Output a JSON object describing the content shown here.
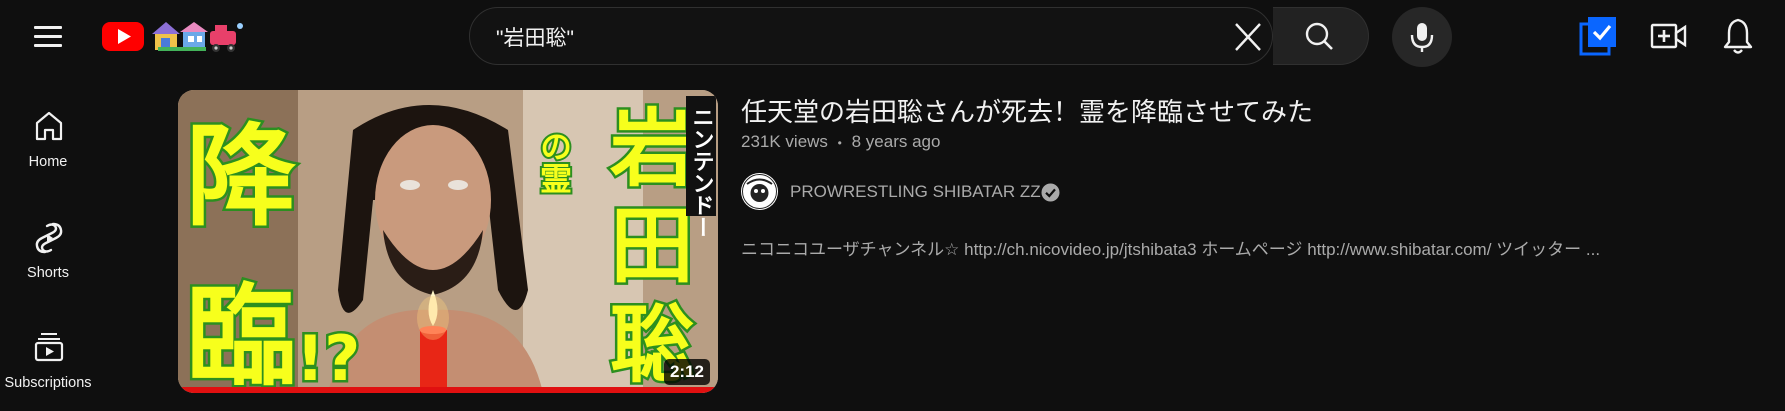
{
  "search": {
    "value": "\"岩田聡\""
  },
  "sidebar": {
    "items": [
      {
        "label": "Home"
      },
      {
        "label": "Shorts"
      },
      {
        "label": "Subscriptions"
      }
    ]
  },
  "result": {
    "title": "任天堂の岩田聡さんが死去！霊を降臨させてみた",
    "views": "231K views",
    "separator": "•",
    "age": "8 years ago",
    "channel": "PROWRESTLING SHIBATAR ZZ",
    "description": "ニコニコユーザチャンネル☆ http://ch.nicovideo.jp/jtshibata3 ホームページ http://www.shibatar.com/ ツイッター ...",
    "duration": "2:12",
    "watch_progress": 1.0,
    "thumbnail_text": {
      "left_chars": [
        "降",
        "臨"
      ],
      "left_suffix": "!?",
      "right_chars": [
        "岩",
        "田",
        "聡"
      ],
      "small_text": "の霊",
      "vertical_label": "ニンテンドー"
    }
  },
  "colors": {
    "background": "#0f0f0f",
    "text_primary": "#f1f1f1",
    "text_secondary": "#aaaaaa",
    "progress": "#e01010",
    "thumb_text": "#f7ff1c",
    "thumb_outline": "#2c8f1f",
    "studio_icon": "#0a66ff"
  },
  "icons": [
    "menu-icon",
    "youtube-logo",
    "clear-icon",
    "search-icon",
    "mic-icon",
    "studio-checkbox-icon",
    "create-video-icon",
    "notifications-bell-icon",
    "home-icon",
    "shorts-icon",
    "subscriptions-icon",
    "verified-icon"
  ]
}
